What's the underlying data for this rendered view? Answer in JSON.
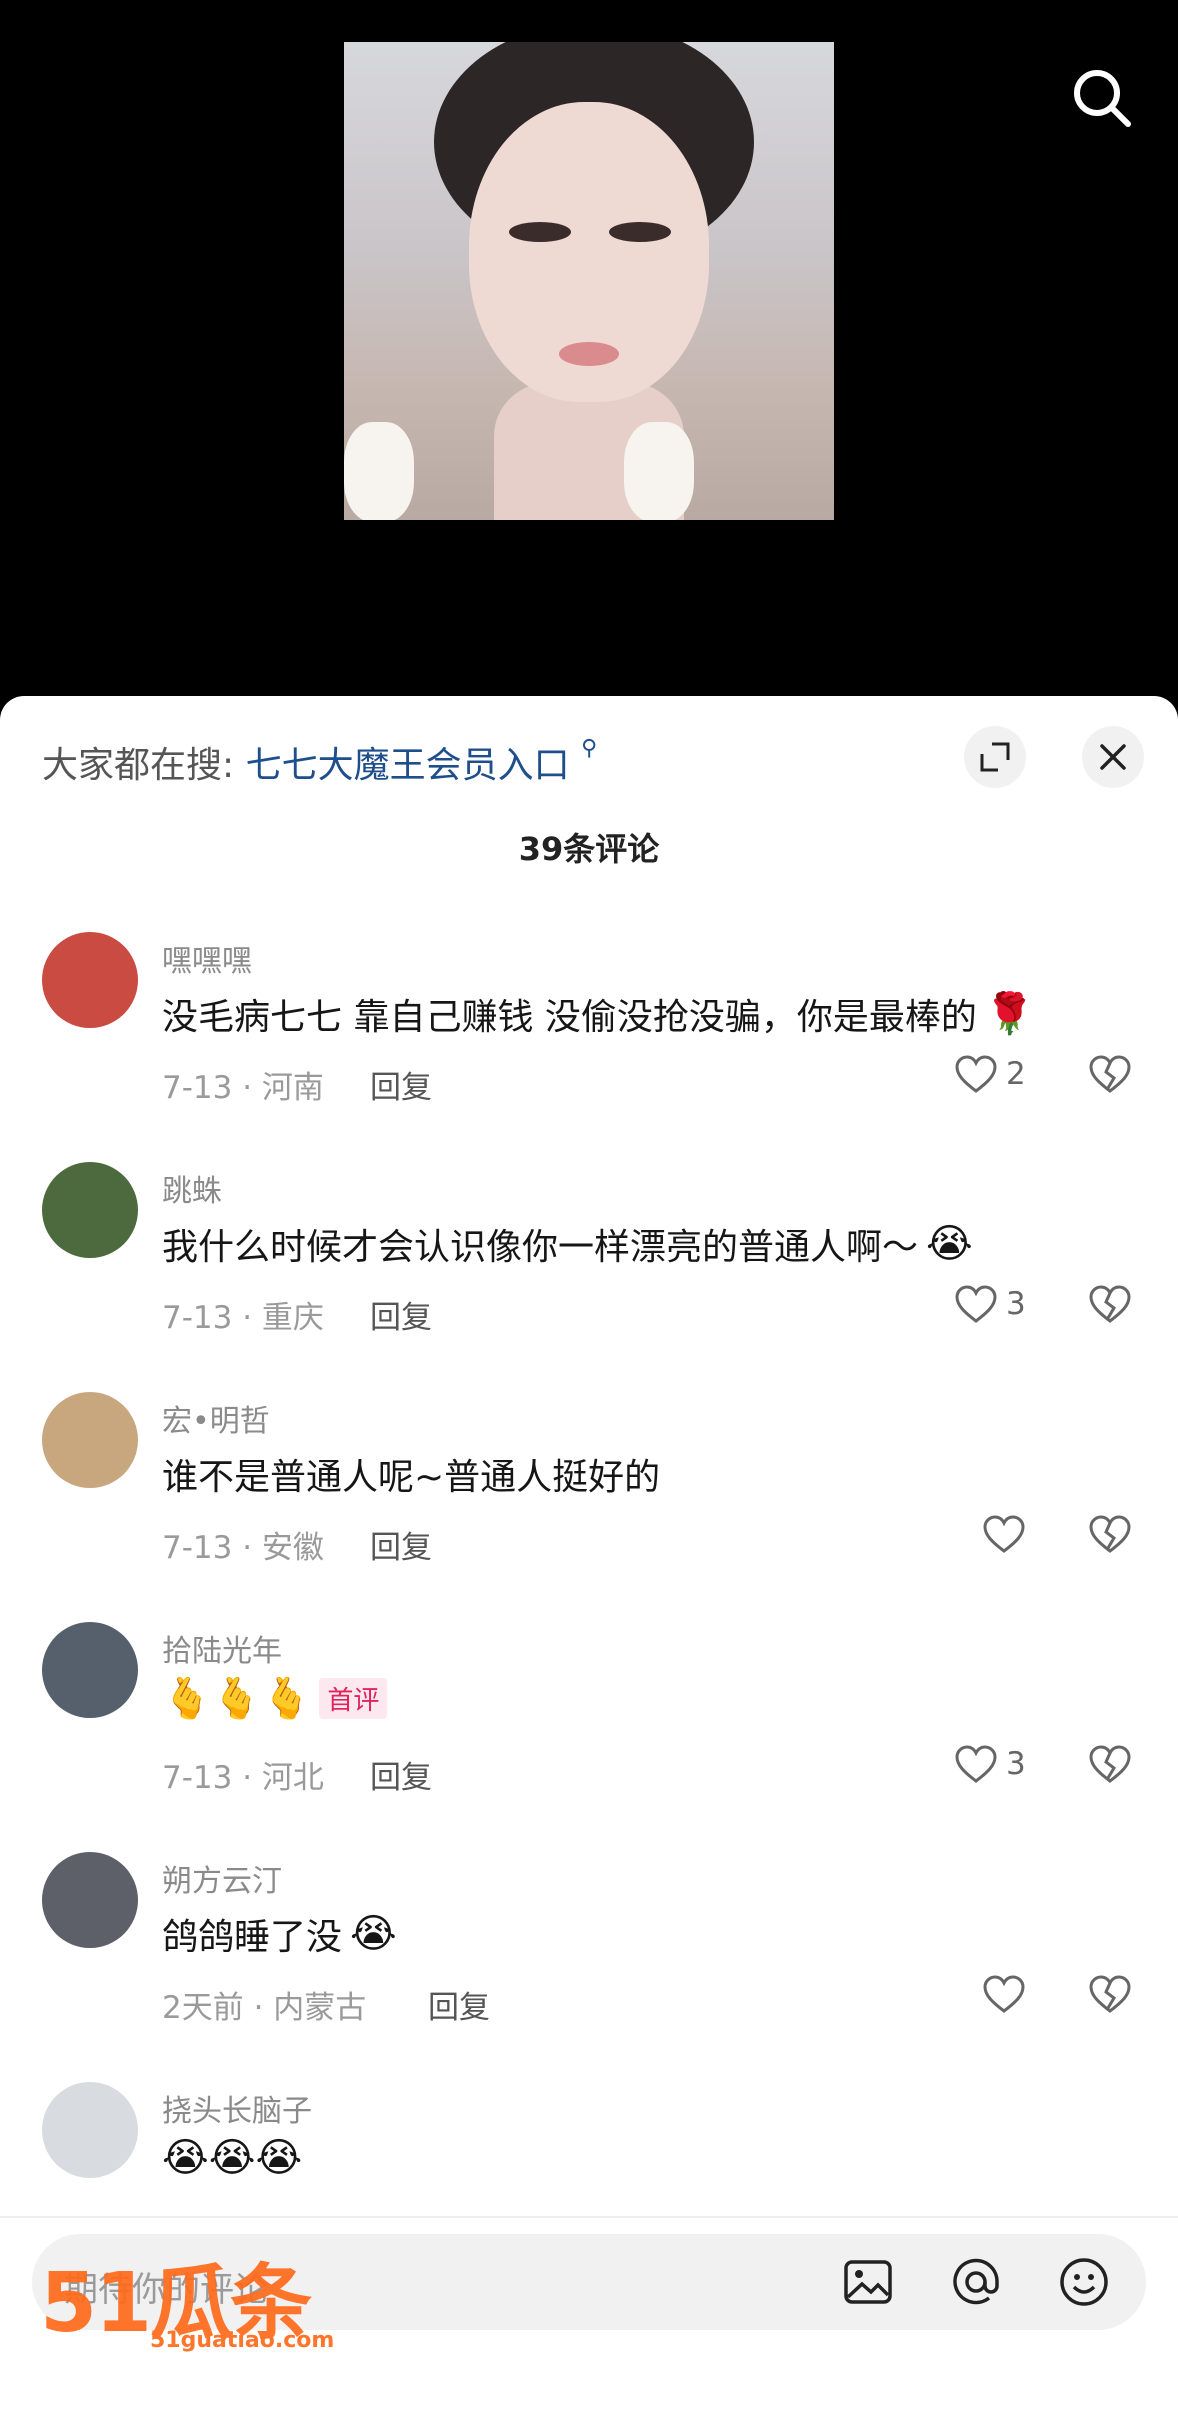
{
  "header": {
    "search_prefix": "大家都在搜:",
    "search_link": "七七大魔王会员入口",
    "search_link_icon": "search-icon"
  },
  "comment_count": "39条评论",
  "reply_label": "回复",
  "comments": [
    {
      "user": "嘿嘿嘿",
      "text": "没毛病七七 靠自己赚钱 没偷没抢没骗，你是最棒的",
      "emoji": "🌹",
      "meta": "7-13 · 河南",
      "likes": "2",
      "avatar_color": "#c94b42"
    },
    {
      "user": "跳蛛",
      "text": "我什么时候才会认识像你一样漂亮的普通人啊～",
      "emoji": "😭",
      "meta": "7-13 · 重庆",
      "likes": "3",
      "avatar_color": "#4c6a3d"
    },
    {
      "user": "宏•明哲",
      "text": "谁不是普通人呢~普通人挺好的",
      "emoji": "",
      "meta": "7-13 · 安徽",
      "likes": "",
      "avatar_color": "#c9a77e"
    },
    {
      "user": "拾陆光年",
      "text": "🫰🫰🫰",
      "emoji": "",
      "badge": "首评",
      "meta": "7-13 · 河北",
      "likes": "3",
      "avatar_color": "#56606c"
    },
    {
      "user": "朔方云汀",
      "text": "鸽鸽睡了没",
      "emoji": "😭",
      "meta": "2天前 · 内蒙古",
      "likes": "",
      "avatar_color": "#5d6068"
    },
    {
      "user": "挠头长脑子",
      "text": "😭😭😭",
      "emoji": "",
      "meta": "",
      "likes": "",
      "avatar_color": "#d8dce0"
    }
  ],
  "input": {
    "placeholder": "期待你的评论"
  },
  "watermark": {
    "logo": "51瓜条",
    "url": "51guatiao.com"
  },
  "colors": {
    "link": "#1f4e8c",
    "badge": "#e0245e",
    "watermark": "#ff6a1a"
  }
}
